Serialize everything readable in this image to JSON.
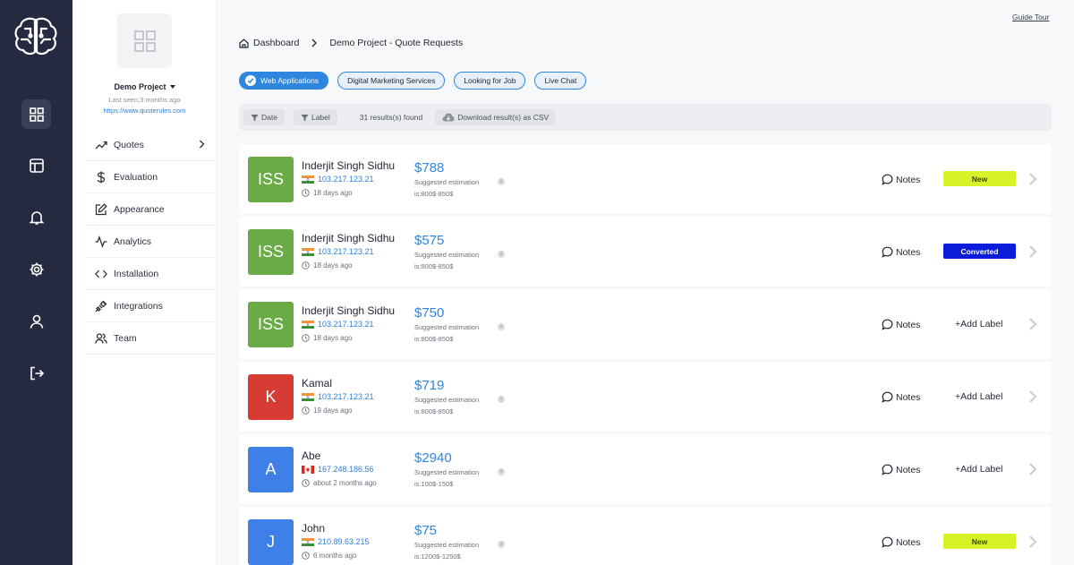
{
  "app": {
    "guide_tour": "Guide Tour"
  },
  "rail": {
    "items": [
      {
        "icon": "grid-icon",
        "active": true
      },
      {
        "icon": "layout-icon",
        "active": false
      },
      {
        "icon": "bell-icon",
        "active": false
      },
      {
        "icon": "gear-icon",
        "active": false
      },
      {
        "icon": "user-icon",
        "active": false
      },
      {
        "icon": "logout-icon",
        "active": false
      }
    ]
  },
  "project": {
    "name": "Demo Project",
    "last_seen": "Last seen,3 months ago",
    "url": "https://www.quoterules.com"
  },
  "menu": {
    "items": [
      {
        "label": "Quotes",
        "icon": "trend-icon",
        "has_chevron": true
      },
      {
        "label": "Evaluation",
        "icon": "dollar-icon"
      },
      {
        "label": "Appearance",
        "icon": "edit-icon"
      },
      {
        "label": "Analytics",
        "icon": "pulse-icon"
      },
      {
        "label": "Installation",
        "icon": "code-icon"
      },
      {
        "label": "Integrations",
        "icon": "plug-icon"
      },
      {
        "label": "Team",
        "icon": "team-icon"
      }
    ]
  },
  "breadcrumb": {
    "home": "Dashboard",
    "current": "Demo Project - Quote Requests"
  },
  "tabs": [
    {
      "label": "Web Applications",
      "active": true
    },
    {
      "label": "Digital Marketing Services",
      "active": false
    },
    {
      "label": "Looking for Job",
      "active": false
    },
    {
      "label": "Live Chat",
      "active": false
    }
  ],
  "filters": {
    "date": "Date",
    "label": "Label",
    "results": "31 results(s) found",
    "download": "Download result(s) as CSV"
  },
  "quotes": [
    {
      "initials": "ISS",
      "avatar_color": "#6aab46",
      "name": "Inderjit Singh Sidhu",
      "flag": "india",
      "ip": "103.217.123.21",
      "time": "18 days ago",
      "price": "$788",
      "est_label": "Suggested estimation",
      "range": "is:800$-850$",
      "notes": "Notes",
      "label": "New",
      "label_bg": "#d7f226",
      "label_color": "#3a4a00"
    },
    {
      "initials": "ISS",
      "avatar_color": "#6aab46",
      "name": "Inderjit Singh Sidhu",
      "flag": "india",
      "ip": "103.217.123.21",
      "time": "18 days ago",
      "price": "$575",
      "est_label": "Suggested estimation",
      "range": "is:800$-850$",
      "notes": "Notes",
      "label": "Converted",
      "label_bg": "#0a1bd9",
      "label_color": "#ffffff"
    },
    {
      "initials": "ISS",
      "avatar_color": "#6aab46",
      "name": "Inderjit Singh Sidhu",
      "flag": "india",
      "ip": "103.217.123.21",
      "time": "18 days ago",
      "price": "$750",
      "est_label": "Suggested estimation",
      "range": "is:800$-850$",
      "notes": "Notes",
      "add_label": "+Add Label"
    },
    {
      "initials": "K",
      "avatar_color": "#d63b34",
      "name": "Kamal",
      "flag": "india",
      "ip": "103.217.123.21",
      "time": "19 days ago",
      "price": "$719",
      "est_label": "Suggested estimation",
      "range": "is:800$-850$",
      "notes": "Notes",
      "add_label": "+Add Label"
    },
    {
      "initials": "A",
      "avatar_color": "#3f7fe8",
      "name": "Abe",
      "flag": "canada",
      "ip": "167.248.186.56",
      "time": "about 2 months ago",
      "price": "$2940",
      "est_label": "Suggested estimation",
      "range": "is:100$-150$",
      "notes": "Notes",
      "add_label": "+Add Label"
    },
    {
      "initials": "J",
      "avatar_color": "#3f7fe8",
      "name": "John",
      "flag": "india",
      "ip": "210.89.63.215",
      "time": "6 months ago",
      "price": "$75",
      "est_label": "Suggested estimation",
      "range": "is:1200$-1250$",
      "notes": "Notes",
      "label": "New",
      "label_bg": "#d7f226",
      "label_color": "#3a4a00"
    }
  ]
}
